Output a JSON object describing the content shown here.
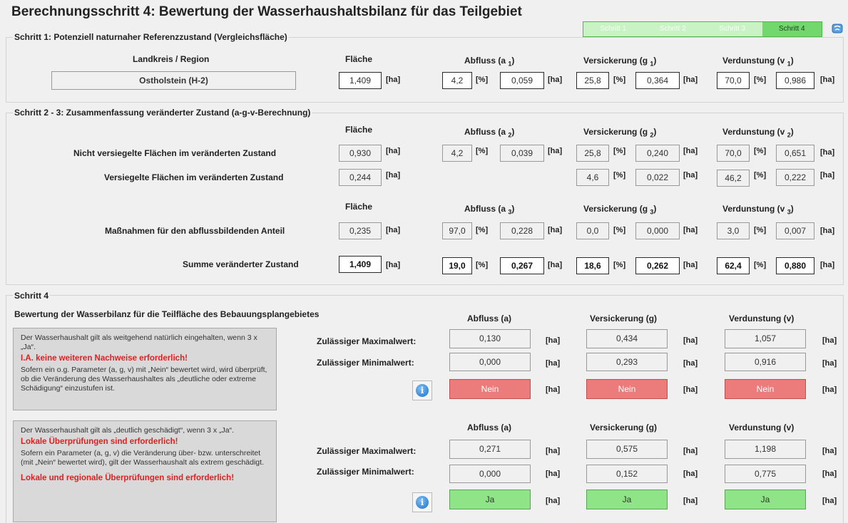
{
  "title": "Berechnungsschritt 4: Bewertung der Wasserhaushaltsbilanz für das Teilgebiet",
  "steps": [
    "Schritt 1",
    "Schritt 2",
    "Schritt 3",
    "Schritt 4"
  ],
  "active_step": "Schritt 4",
  "units": {
    "ha": "[ha]",
    "pct": "[%]"
  },
  "s1": {
    "title": "Schritt 1: Potenziell naturnaher Referenzzustand (Vergleichsfläche)",
    "region_header": "Landkreis / Region",
    "flaeche_header": "Fläche",
    "abfluss_header": "Abfluss (a",
    "abfluss_sub": "1",
    "versickerung_header": "Versickerung (g",
    "versickerung_sub": "1",
    "verdunstung_header": "Verdunstung (v",
    "verdunstung_sub": "1",
    "close": ")",
    "region": "Ostholstein (H-2)",
    "flaeche": "1,409",
    "a_pct": "4,2",
    "a_ha": "0,059",
    "g_pct": "25,8",
    "g_ha": "0,364",
    "v_pct": "70,0",
    "v_ha": "0,986"
  },
  "s23": {
    "title": "Schritt 2 - 3: Zusammenfassung veränderter Zustand (a-g-v-Berechnung)",
    "flaeche_header": "Fläche",
    "abfluss2": "Abfluss (a",
    "sub2": "2",
    "versickerung2": "Versickerung (g",
    "verdunstung2": "Verdunstung (v",
    "abfluss3": "Abfluss (a",
    "sub3": "3",
    "versickerung3": "Versickerung (g",
    "verdunstung3": "Verdunstung (v",
    "close": ")",
    "row1": {
      "label": "Nicht versiegelte Flächen im veränderten  Zustand",
      "flaeche": "0,930",
      "a_pct": "4,2",
      "a_ha": "0,039",
      "g_pct": "25,8",
      "g_ha": "0,240",
      "v_pct": "70,0",
      "v_ha": "0,651"
    },
    "row2": {
      "label": "Versiegelte Flächen im veränderten  Zustand",
      "flaeche": "0,244",
      "g_pct": "4,6",
      "g_ha": "0,022",
      "v_pct": "46,2",
      "v_ha": "0,222"
    },
    "row3": {
      "label": "Maßnahmen für den abflussbildenden Anteil",
      "flaeche": "0,235",
      "a_pct": "97,0",
      "a_ha": "0,228",
      "g_pct": "0,0",
      "g_ha": "0,000",
      "v_pct": "3,0",
      "v_ha": "0,007"
    },
    "sum": {
      "label": "Summe veränderter Zustand",
      "flaeche": "1,409",
      "a_pct": "19,0",
      "a_ha": "0,267",
      "g_pct": "18,6",
      "g_ha": "0,262",
      "v_pct": "62,4",
      "v_ha": "0,880"
    }
  },
  "s4": {
    "title": "Schritt 4",
    "subtitle": "Bewertung der Wasserbilanz für die Teilfläche des Bebauungsplangebietes",
    "abfluss": "Abfluss (a)",
    "versickerung": "Versickerung (g)",
    "verdunstung": "Verdunstung (v)",
    "max_label": "Zulässiger Maximalwert:",
    "min_label": "Zulässiger Minimalwert:",
    "note1": {
      "text1": "Der Wasserhaushalt gilt als weitgehend natürlich eingehalten, wenn 3 x „Ja“.",
      "red1": "I.A. keine weiteren Nachweise erforderlich!",
      "text2": "Sofern ein o.g. Parameter (a, g, v) mit „Nein“ bewertet wird, wird überprüft, ob die Veränderung des Wasserhaushaltes als „deutliche oder extreme Schädigung“ einzustufen ist."
    },
    "note2": {
      "text1": "Der Wasserhaushalt gilt als „deutlich geschädigt“, wenn 3 x „Ja“.",
      "red1": "Lokale Überprüfungen sind erforderlich!",
      "text2": "Sofern ein Parameter (a, g, v) die Veränderung über- bzw. unterschreitet (mit „Nein“ bewertet wird), gilt der Wasserhaushalt als extrem geschädigt.",
      "red2": "Lokale und regionale Überprüfungen sind erforderlich!"
    },
    "block1": {
      "a_max": "0,130",
      "a_min": "0,000",
      "a_res": "Nein",
      "g_max": "0,434",
      "g_min": "0,293",
      "g_res": "Nein",
      "v_max": "1,057",
      "v_min": "0,916",
      "v_res": "Nein"
    },
    "block2": {
      "a_max": "0,271",
      "a_min": "0,000",
      "a_res": "Ja",
      "g_max": "0,575",
      "g_min": "0,152",
      "g_res": "Ja",
      "v_max": "1,198",
      "v_min": "0,775",
      "v_res": "Ja"
    }
  }
}
